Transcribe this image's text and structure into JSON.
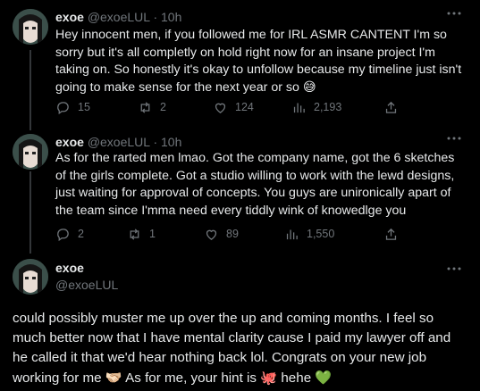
{
  "tweets": [
    {
      "name": "exoe",
      "handle": "@exoeLUL",
      "dot": "·",
      "time": "10h",
      "text_before_emoji": "Hey innocent men, if you followed me for IRL ASMR CANTENT I'm so sorry but it's all completly on hold right now for an insane project I'm taking on. So honestly it's okay to unfollow because my timeline just isn't going to make sense for the next year or so ",
      "emoji": "😅",
      "replies": "15",
      "retweets": "2",
      "likes": "124",
      "views": "2,193"
    },
    {
      "name": "exoe",
      "handle": "@exoeLUL",
      "dot": "·",
      "time": "10h",
      "text": "As for the rarted men lmao. Got the company name, got the 6 sketches of the girls complete. Got a studio willing to work with the lewd designs, just waiting for approval of concepts. You guys are unironically apart of the team since I'mma need every tiddly wink of knowedlge you",
      "replies": "2",
      "retweets": "1",
      "likes": "89",
      "views": "1,550"
    },
    {
      "name": "exoe",
      "handle": "@exoeLUL",
      "text_part1": "could possibly muster me up over the up and coming months. I feel so much better now that I have mental clarity cause I paid my lawyer off and he called it that we'd hear nothing back lol. Congrats on your new job working for me ",
      "emoji1": "🫱🏻‍🫲🏼",
      "text_part2": " As for me, your hint is ",
      "emoji2": "🐙",
      "text_part3": " hehe ",
      "emoji3": "💚"
    }
  ],
  "colors": {
    "background": "#000000",
    "text": "#e7e9ea",
    "secondary": "#71767b",
    "thread_line": "#333639"
  },
  "icons": [
    "more-icon",
    "reply-icon",
    "retweet-icon",
    "like-icon",
    "views-icon",
    "share-icon"
  ]
}
